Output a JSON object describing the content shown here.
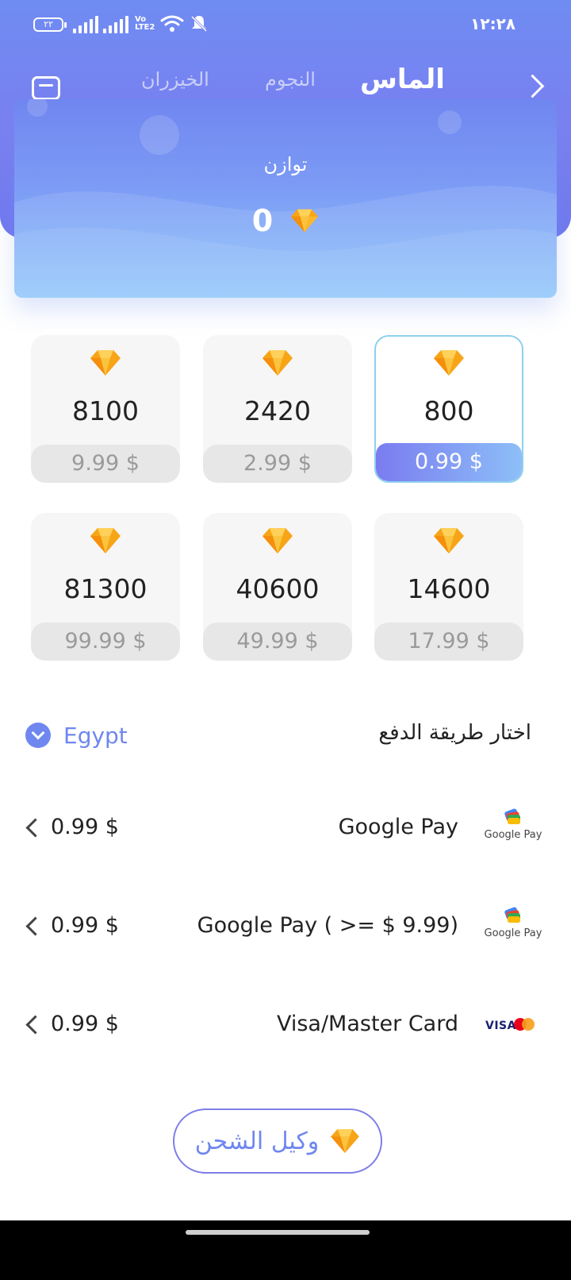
{
  "status_bar": {
    "battery": "٢٢",
    "volte": "Vo LTE2",
    "time": "١٢:٢٨",
    "icons": [
      "battery-icon",
      "signal-icon",
      "signal-icon",
      "volte-icon",
      "wifi-icon",
      "silent-icon"
    ]
  },
  "tabs": [
    {
      "label": "الماس",
      "active": true
    },
    {
      "label": "النجوم",
      "active": false
    },
    {
      "label": "الخيزران",
      "active": false
    }
  ],
  "header_icons": {
    "left": "wallet-icon",
    "right": "chevron-right-icon"
  },
  "balance": {
    "label": "توازن",
    "value": "0",
    "icon": "diamond-icon"
  },
  "packages": [
    {
      "amount": "800",
      "price": "0.99 $",
      "selected": true
    },
    {
      "amount": "2420",
      "price": "2.99 $",
      "selected": false
    },
    {
      "amount": "8100",
      "price": "9.99 $",
      "selected": false
    },
    {
      "amount": "14600",
      "price": "17.99 $",
      "selected": false
    },
    {
      "amount": "40600",
      "price": "49.99 $",
      "selected": false
    },
    {
      "amount": "81300",
      "price": "99.99 $",
      "selected": false
    }
  ],
  "payment": {
    "title": "اختار طريقة الدفع",
    "region": "Egypt",
    "methods": [
      {
        "name": "Google Pay",
        "price": "0.99 $",
        "logo_text": "Google Pay"
      },
      {
        "name": "Google Pay ( >= $ 9.99)",
        "price": "0.99 $",
        "logo_text": "Google Pay"
      },
      {
        "name": "Visa/Master Card",
        "price": "0.99 $",
        "logo_text": "VISA"
      }
    ]
  },
  "agent_button": {
    "label": "وكيل الشحن"
  },
  "colors": {
    "accent": "#6f87ef",
    "header": "#7a7ff0",
    "gem_orange": "#f8a617",
    "selected_border": "#8fd0ef"
  }
}
